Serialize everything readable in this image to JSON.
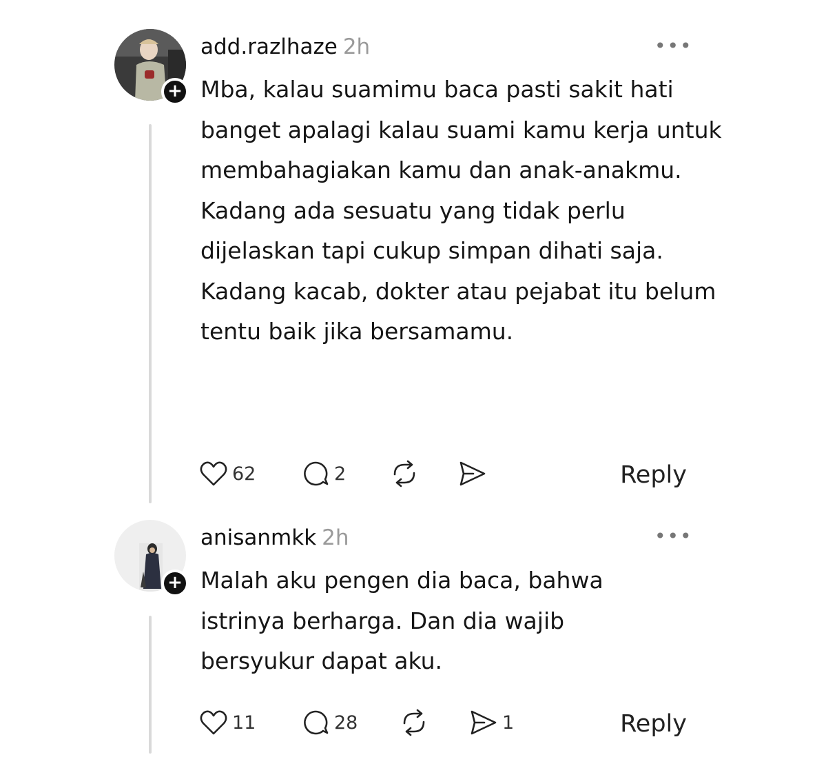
{
  "comments": [
    {
      "username": "add.razlhaze",
      "time": "2h",
      "more_label": "•••",
      "follow_icon": "plus-icon",
      "paragraphs": [
        "Mba, kalau suamimu baca pasti sakit hati banget apalagi kalau suami kamu kerja untuk membahagiakan kamu dan anak-anakmu.",
        "Kadang ada sesuatu yang tidak perlu dijelaskan tapi cukup simpan dihati saja.",
        "Kadang kacab, dokter atau pejabat itu belum tentu baik jika bersamamu."
      ],
      "likes": "62",
      "replies": "2",
      "reposts": "",
      "shares": "",
      "reply_label": "Reply"
    },
    {
      "username": "anisanmkk",
      "time": "2h",
      "more_label": "•••",
      "follow_icon": "plus-icon",
      "paragraphs": [
        "Malah aku pengen dia baca, bahwa istrinya berharga. Dan dia wajib bersyukur dapat aku."
      ],
      "likes": "11",
      "replies": "28",
      "reposts": "",
      "shares": "1",
      "reply_label": "Reply"
    }
  ],
  "colors": {
    "text": "#161616",
    "muted": "#9a9a9a",
    "line": "#d9d9d9",
    "badge": "#111111"
  }
}
